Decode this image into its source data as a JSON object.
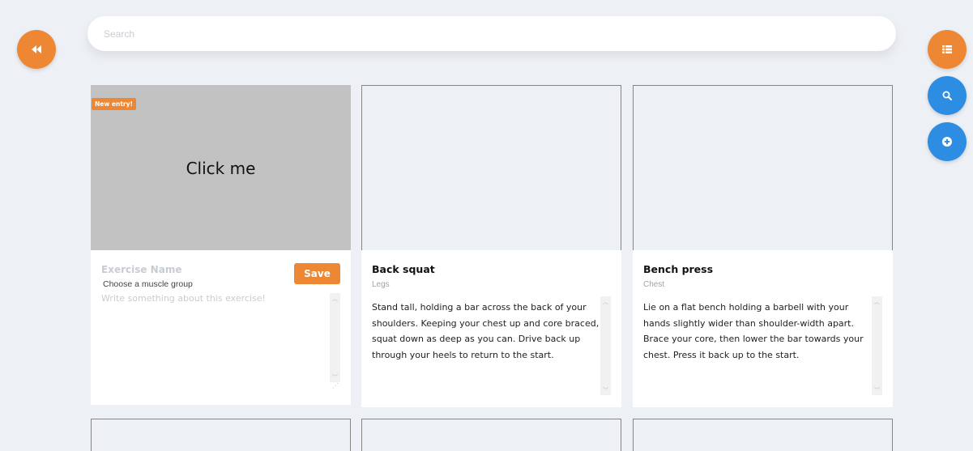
{
  "search": {
    "placeholder": "Search"
  },
  "new_entry": {
    "badge": "New entry!",
    "image_prompt": "Click me",
    "name_placeholder": "Exercise Name",
    "save_label": "Save",
    "muscle_group_placeholder": "Choose a muscle group",
    "description_placeholder": "Write something about this exercise!"
  },
  "exercises": [
    {
      "name": "Back squat",
      "group": "Legs",
      "description": "Stand tall, holding a bar across the back of your shoulders. Keeping your chest up and core braced, squat down as deep as you can. Drive back up through your heels to return to the start."
    },
    {
      "name": "Bench press",
      "group": "Chest",
      "description": "Lie on a flat bench holding a barbell with your hands slightly wider than shoulder-width apart. Brace your core, then lower the bar towards your chest. Press it back up to the start."
    }
  ],
  "icons": {
    "back": "rewind-icon",
    "list": "list-icon",
    "search": "search-icon",
    "add": "plus-circle-icon"
  },
  "colors": {
    "orange": "#ee8733",
    "blue": "#2d8de2",
    "background": "#edf0f5"
  }
}
